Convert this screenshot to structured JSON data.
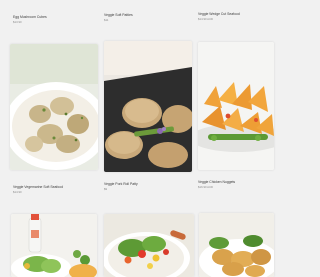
{
  "products": [
    {
      "title": "Egg Mushroom Cubes",
      "price": "$13.90",
      "image": "chicken-pieces-in-bowl"
    },
    {
      "title": "Veggie Soft Patties",
      "price": "$11",
      "image": "veggie-patties-on-plate"
    },
    {
      "title": "Veggie Wedge Cut Seafood",
      "price": "$14.90 AUD",
      "image": "potato-wedges-on-plate"
    },
    {
      "title": "Veggie Vegemarine Soft Seafood",
      "price": "$14.90",
      "image": "sauce-bottle-and-salad"
    },
    {
      "title": "Veggie Pork Roll Patty",
      "price": "$9",
      "image": "colorful-salad-bowl"
    },
    {
      "title": "Veggie Chicken Nuggets",
      "price": "$16.90 AUD",
      "image": "nuggets-on-plate"
    }
  ]
}
